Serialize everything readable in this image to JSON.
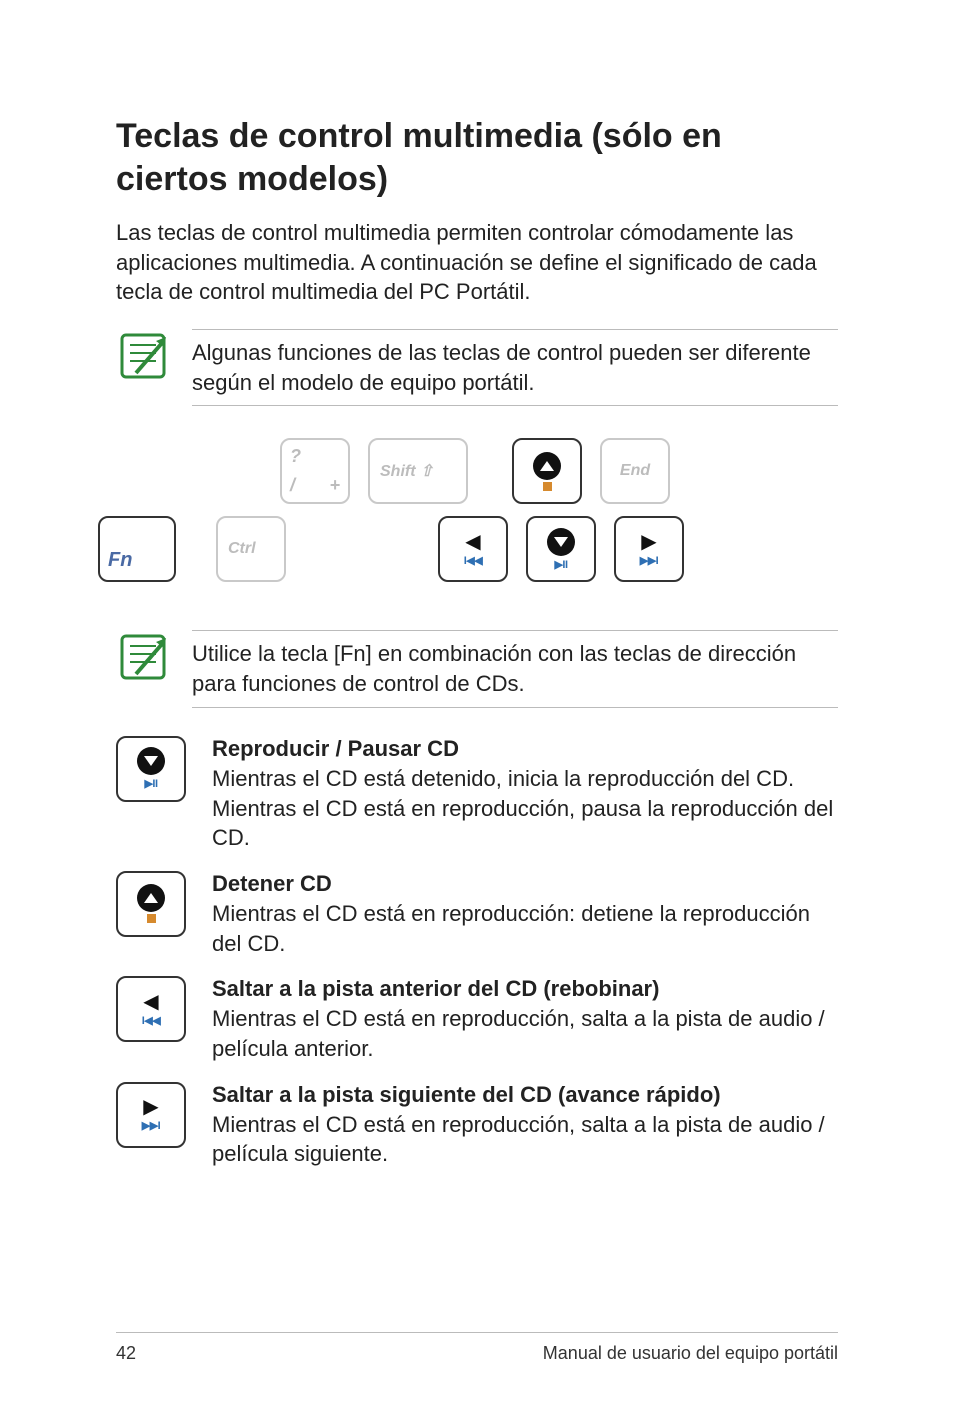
{
  "title": "Teclas de control multimedia (sólo en ciertos modelos)",
  "intro": "Las teclas de control multimedia permiten controlar cómodamente las aplicaciones multimedia. A continuación se define el significado de cada tecla de control multimedia del PC Portátil.",
  "note1": "Algunas funciones de las teclas de control pueden ser diferente según el modelo de equipo portátil.",
  "keyboard": {
    "fn": "Fn",
    "slash_top": "?",
    "slash_bl": "/",
    "slash_br": "+",
    "shift": "Shift ⇧",
    "ctrl": "Ctrl",
    "end": "End",
    "prev_sub": "I◀◀",
    "play_sub": "▶II",
    "next_sub": "▶▶I"
  },
  "note2": "Utilice la tecla [Fn] en combinación con las teclas de dirección para funciones de control de CDs.",
  "functions": [
    {
      "title": "Reproducir / Pausar CD",
      "desc": "Mientras el CD está detenido, inicia la reproducción del CD.\nMientras el CD está en reproducción, pausa la reproducción del CD.",
      "key": "play"
    },
    {
      "title": "Detener CD",
      "desc": "Mientras el CD está en reproducción: detiene la reproducción del CD.",
      "key": "stop"
    },
    {
      "title": "Saltar a la pista anterior del CD (rebobinar)",
      "desc": "Mientras el CD está en reproducción, salta a la pista de audio / película anterior.",
      "key": "prev"
    },
    {
      "title": "Saltar a la pista siguiente del CD (avance rápido)",
      "desc": "Mientras el CD está en reproducción, salta a la pista de audio / película siguiente.",
      "key": "next"
    }
  ],
  "footer": {
    "page": "42",
    "label": "Manual de usuario del equipo portátil"
  }
}
